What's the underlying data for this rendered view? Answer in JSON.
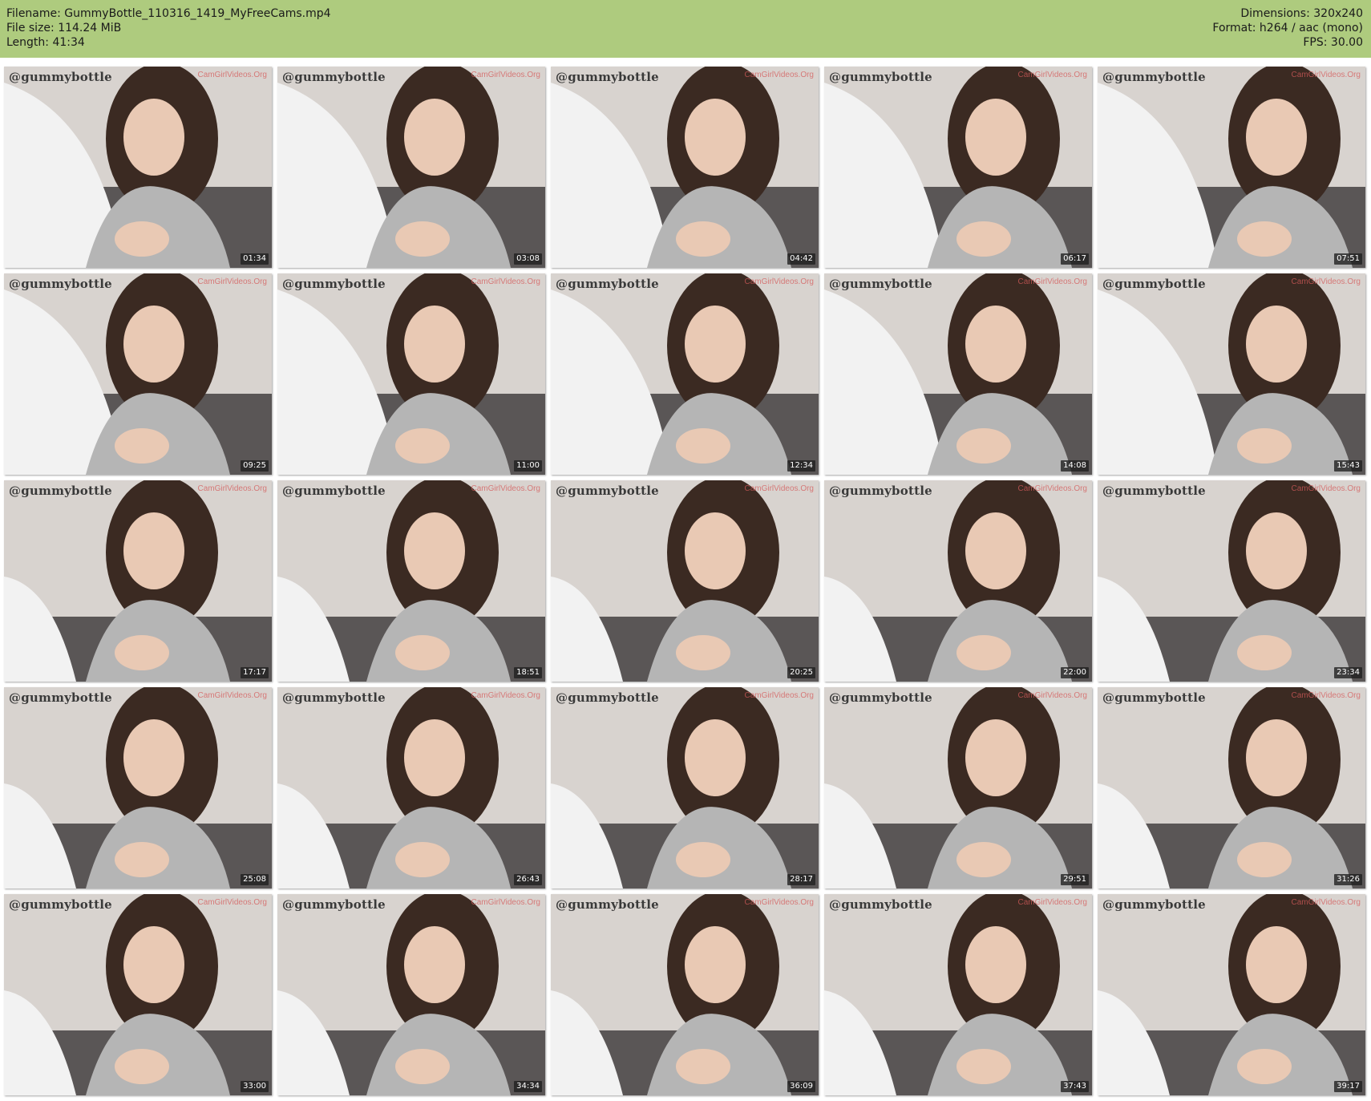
{
  "header": {
    "filename": "Filename: GummyBottle_110316_1419_MyFreeCams.mp4",
    "filesize": "File size: 114.24 MiB",
    "length": "Length: 41:34",
    "dimensions": "Dimensions: 320x240",
    "format": "Format: h264 / aac (mono)",
    "fps": "FPS: 30.00"
  },
  "watermark": "@gummybottle",
  "site_mark": "CamGirlVideos.Org",
  "thumbnails": [
    {
      "time": "01:34"
    },
    {
      "time": "03:08"
    },
    {
      "time": "04:42"
    },
    {
      "time": "06:17"
    },
    {
      "time": "07:51"
    },
    {
      "time": "09:25"
    },
    {
      "time": "11:00"
    },
    {
      "time": "12:34"
    },
    {
      "time": "14:08"
    },
    {
      "time": "15:43"
    },
    {
      "time": "17:17"
    },
    {
      "time": "18:51"
    },
    {
      "time": "20:25"
    },
    {
      "time": "22:00"
    },
    {
      "time": "23:34"
    },
    {
      "time": "25:08"
    },
    {
      "time": "26:43"
    },
    {
      "time": "28:17"
    },
    {
      "time": "29:51"
    },
    {
      "time": "31:26"
    },
    {
      "time": "33:00"
    },
    {
      "time": "34:34"
    },
    {
      "time": "36:09"
    },
    {
      "time": "37:43"
    },
    {
      "time": "39:17"
    }
  ],
  "colors": {
    "header_bg": "#aecb7e",
    "wall": "#d8d3cf",
    "hair": "#3b2a22",
    "skin": "#e9c9b4",
    "top": "#b5b5b5",
    "bedding": "#f2f2f2"
  }
}
